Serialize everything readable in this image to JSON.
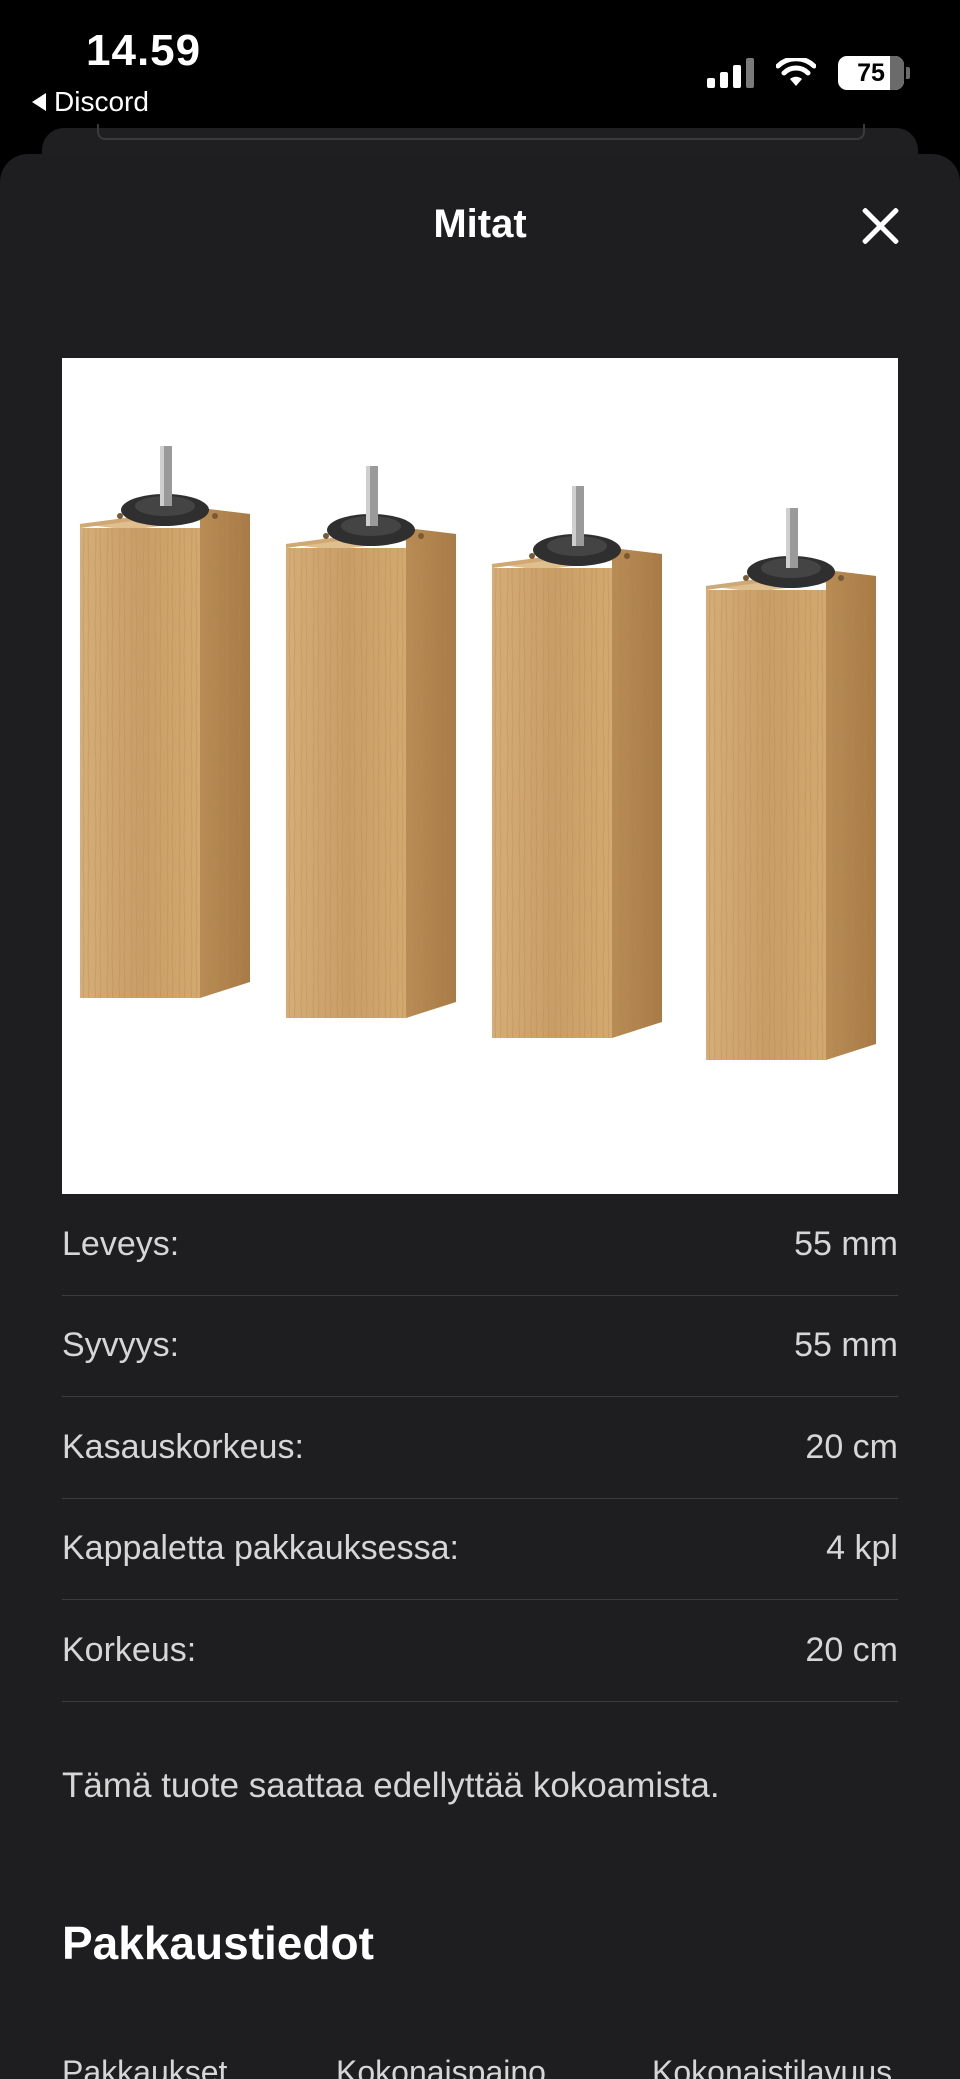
{
  "status_bar": {
    "time": "14.59",
    "back_app": "Discord",
    "battery": "75"
  },
  "sheet": {
    "title": "Mitat"
  },
  "product_image": {
    "description_icon": "furniture-legs-image",
    "leg_count": 4
  },
  "dimensions": [
    {
      "label": "Leveys:",
      "value": "55 mm"
    },
    {
      "label": "Syvyys:",
      "value": "55 mm"
    },
    {
      "label": "Kasauskorkeus:",
      "value": "20 cm"
    },
    {
      "label": "Kappaletta pakkauksessa:",
      "value": "4 kpl"
    },
    {
      "label": "Korkeus:",
      "value": "20 cm"
    }
  ],
  "note": "Tämä tuote saattaa edellyttää kokoamista.",
  "package_section": {
    "title": "Pakkaustiedot",
    "columns": [
      "Pakkaukset",
      "Kokonaispaino",
      "Kokonaistilavuus"
    ]
  },
  "colors": {
    "sheet_bg": "#1e1e20",
    "divider": "#3c3c3e",
    "text_secondary": "#d6d6d6"
  }
}
